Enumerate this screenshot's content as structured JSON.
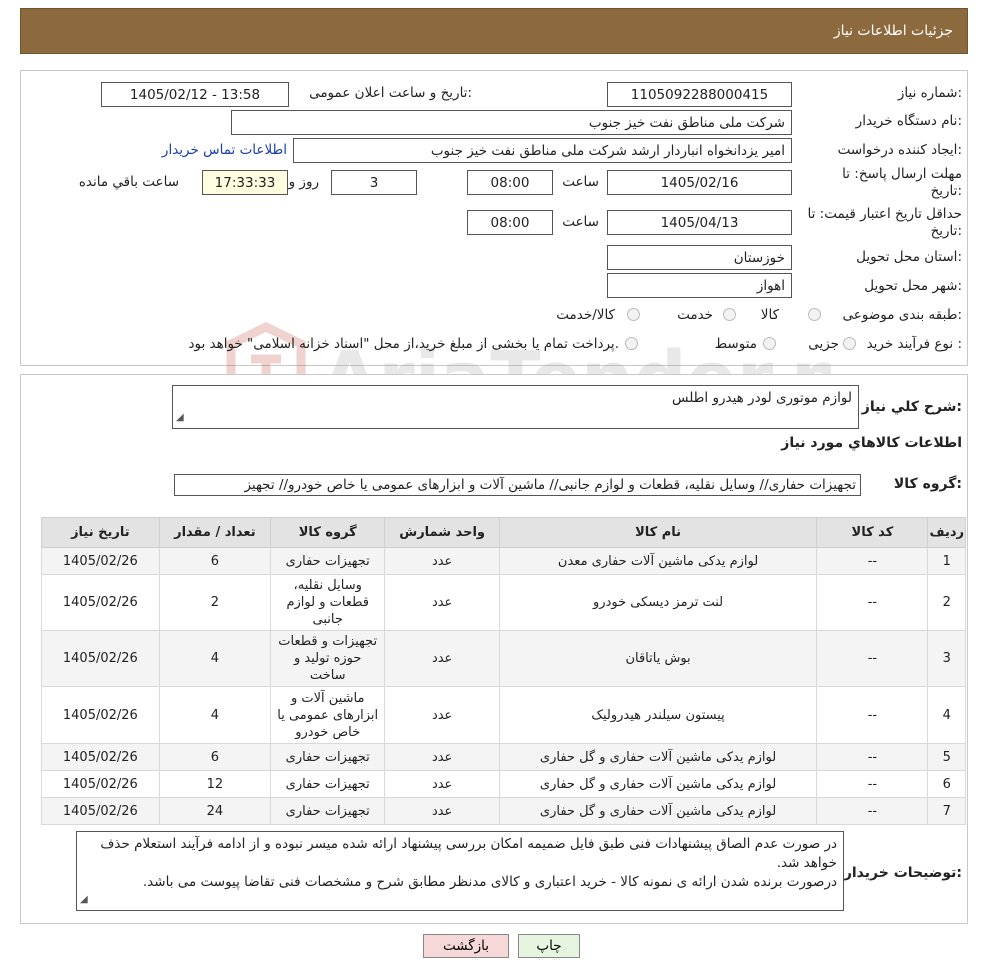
{
  "header": {
    "title": "جزئیات اطلاعات نیاز"
  },
  "form": {
    "need_number_label": "شماره نیاز:",
    "need_number": "1105092288000415",
    "announce_label": "تاریخ و ساعت اعلان عمومی:",
    "announce_value": "1405/02/12 - 13:58",
    "buyer_org_label": "نام دستگاه خریدار:",
    "buyer_org": "شرکت ملی مناطق نفت خیز جنوب",
    "creator_label": "ایجاد کننده درخواست:",
    "creator": "امیر یزدانخواه انباردار ارشد شرکت ملی مناطق نفت خیز جنوب",
    "contact_link": "اطلاعات تماس خریدار",
    "deadline_label_1": "مهلت ارسال پاسخ: تا",
    "deadline_label_2": "تاریخ:",
    "deadline_date": "1405/02/16",
    "time_label": "ساعت",
    "deadline_time": "08:00",
    "days_value": "3",
    "days_label": "روز و",
    "remaining_time": "17:33:33",
    "remaining_label": "ساعت باقي مانده",
    "validity_label_1": "حداقل تاریخ اعتبار قیمت: تا",
    "validity_label_2": "تاریخ:",
    "validity_date": "1405/04/13",
    "validity_time": "08:00",
    "province_label": "استان محل تحویل:",
    "province": "خوزستان",
    "city_label": "شهر محل تحویل:",
    "city": "اهواز",
    "category_label": "طبقه بندی موضوعی:",
    "category_options": [
      "کالا",
      "خدمت",
      "کالا/خدمت"
    ],
    "process_label": "نوع فرآیند خرید :",
    "process_options": [
      "جزیی",
      "متوسط"
    ],
    "process_note": "پرداخت تمام یا بخشی از مبلغ خرید،از محل \"اسناد خزانه اسلامی\" خواهد بود."
  },
  "details": {
    "summary_label": "شرح کلي نياز:",
    "summary": "لوازم موتوری لودر هیدرو اطلس",
    "goods_info_title": "اطلاعات کالاهاي مورد نياز",
    "goods_group_label": "گروه کالا:",
    "goods_group": "تجهیزات حفاری// وسایل نقلیه، قطعات و لوازم جانبی//  ماشین آلات و ابزارهای عمومی یا خاص خودرو// تجهیز",
    "columns": [
      "ردیف",
      "کد کالا",
      "نام کالا",
      "واحد شمارش",
      "گروه کالا",
      "تعداد / مقدار",
      "تاریخ نیاز"
    ],
    "rows": [
      [
        "1",
        "--",
        "لوازم یدکی ماشین آلات حفاری معدن",
        "عدد",
        "تجهیزات حفاری",
        "6",
        "1405/02/26"
      ],
      [
        "2",
        "--",
        "لنت ترمز دیسکی خودرو",
        "عدد",
        "وسایل نقلیه، قطعات و لوازم جانبی",
        "2",
        "1405/02/26"
      ],
      [
        "3",
        "--",
        "بوش یاتاقان",
        "عدد",
        "تجهیزات و قطعات حوزه تولید و ساخت",
        "4",
        "1405/02/26"
      ],
      [
        "4",
        "--",
        "پیستون سیلندر هیدرولیک",
        "عدد",
        "ماشین آلات و ابزارهای عمومی یا خاص خودرو",
        "4",
        "1405/02/26"
      ],
      [
        "5",
        "--",
        "لوازم یدکی ماشین آلات حفاری و گل حفاری",
        "عدد",
        "تجهیزات حفاری",
        "6",
        "1405/02/26"
      ],
      [
        "6",
        "--",
        "لوازم یدکی ماشین آلات حفاری و گل حفاری",
        "عدد",
        "تجهیزات حفاری",
        "12",
        "1405/02/26"
      ],
      [
        "7",
        "--",
        "لوازم یدکی ماشین آلات حفاری و گل حفاری",
        "عدد",
        "تجهیزات حفاری",
        "24",
        "1405/02/26"
      ]
    ],
    "buyer_notes_label": "توضیحات خریدار:",
    "buyer_notes_1": "در صورت عدم الصاق پیشنهادات فنی طبق فایل ضمیمه امکان بررسی پیشنهاد ارائه شده میسر نبوده و از ادامه فرآیند استعلام حذف خواهد شد.",
    "buyer_notes_2": "درصورت برنده شدن ارائه ی نمونه کالا - خرید اعتباری و کالای مدنظر مطابق شرح و مشخصات فنی تقاضا پیوست می باشد."
  },
  "buttons": {
    "print": "چاپ",
    "back": "بازگشت"
  },
  "watermark": {
    "text": "AriaTender.neT"
  },
  "colors": {
    "header_bg": "#8c6a3e",
    "link": "#1a3ea8",
    "back_button_bg": "#f7d8d8",
    "print_button_bg": "#e6f5e0",
    "remaining_bg": "#fffde0"
  }
}
